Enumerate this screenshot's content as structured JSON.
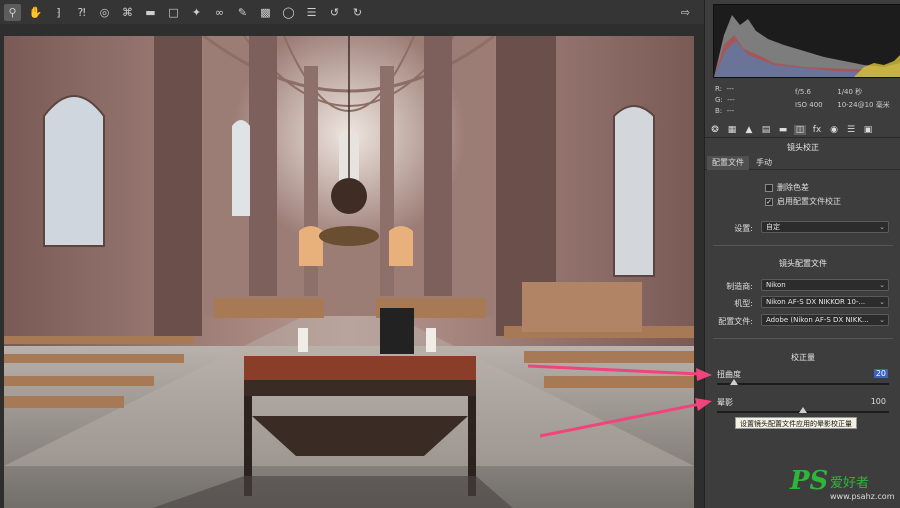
{
  "toolbar": {
    "tools": [
      {
        "icon": "zoom-icon"
      },
      {
        "icon": "hand-icon"
      },
      {
        "icon": "eyedropper-icon"
      },
      {
        "icon": "color-sampler-icon"
      },
      {
        "icon": "target-adjust-icon"
      },
      {
        "icon": "crop-icon"
      },
      {
        "icon": "straighten-icon"
      },
      {
        "icon": "transform-icon"
      },
      {
        "icon": "spot-removal-icon"
      },
      {
        "icon": "red-eye-icon"
      },
      {
        "icon": "brush-icon"
      },
      {
        "icon": "graduated-filter-icon"
      },
      {
        "icon": "radial-filter-icon"
      },
      {
        "icon": "presets-icon"
      },
      {
        "icon": "rotate-left-icon"
      },
      {
        "icon": "rotate-right-icon"
      }
    ],
    "export_icon": "open-preferences-icon"
  },
  "info": {
    "r_label": "R:",
    "r_val": "---",
    "g_label": "G:",
    "g_val": "---",
    "b_label": "B:",
    "b_val": "---",
    "aperture": "f/5.6",
    "shutter": "1/40 秒",
    "iso": "ISO 400",
    "lens": "10-24@10 毫米"
  },
  "panel": {
    "title": "镜头校正",
    "subtabs": [
      "配置文件",
      "手动"
    ],
    "checkbox_remove_ca": "删除色差",
    "checkbox_enable_profile": "启用配置文件校正",
    "setup_label": "设置:",
    "setup_value": "自定",
    "lens_profile_title": "镜头配置文件",
    "make_label": "制造商:",
    "make_value": "Nikon",
    "model_label": "机型:",
    "model_value": "Nikon AF-S DX NIKKOR 10-...",
    "profile_label": "配置文件:",
    "profile_value": "Adobe (Nikon AF-S DX NIKK...",
    "amount_title": "校正量",
    "distortion_label": "扭曲度",
    "distortion_value": "20",
    "vignetting_label": "晕影",
    "vignetting_value": "100",
    "tooltip": "设置镜头配置文件应用的晕影校正量",
    "distortion_level": 0.1,
    "vignetting_level": 0.5
  },
  "colors": {
    "arrow": "#f0457a",
    "highlight": "#3a64b8"
  },
  "watermark": {
    "ps": "PS",
    "cn": "爱好者",
    "url": "www.psahz.com"
  }
}
